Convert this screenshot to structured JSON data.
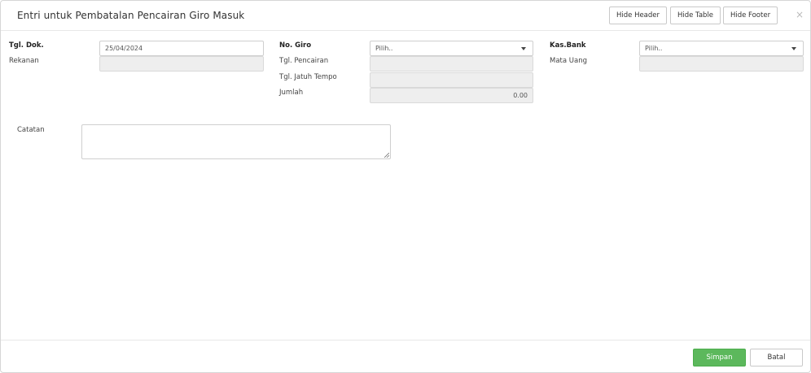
{
  "header": {
    "title": "Entri untuk Pembatalan Pencairan Giro Masuk",
    "hide_header_label": "Hide Header",
    "hide_table_label": "Hide Table",
    "hide_footer_label": "Hide Footer",
    "close_glyph": "×"
  },
  "form": {
    "tgl_dok_label": "Tgl. Dok.",
    "tgl_dok_value": "25/04/2024",
    "rekanan_label": "Rekanan",
    "rekanan_value": "",
    "no_giro_label": "No. Giro",
    "no_giro_value": "Pilih..",
    "tgl_pencairan_label": "Tgl. Pencairan",
    "tgl_pencairan_value": "",
    "tgl_jatuh_tempo_label": "Tgl. Jatuh Tempo",
    "tgl_jatuh_tempo_value": "",
    "jumlah_label": "Jumlah",
    "jumlah_value": "0.00",
    "kas_bank_label": "Kas.Bank",
    "kas_bank_value": "Pilih..",
    "mata_uang_label": "Mata Uang",
    "mata_uang_value": "",
    "catatan_label": "Catatan",
    "catatan_value": ""
  },
  "footer": {
    "save_label": "Simpan",
    "cancel_label": "Batal"
  },
  "colors": {
    "save_button": "#5cb85c",
    "readonly_field": "#eeeeee"
  }
}
